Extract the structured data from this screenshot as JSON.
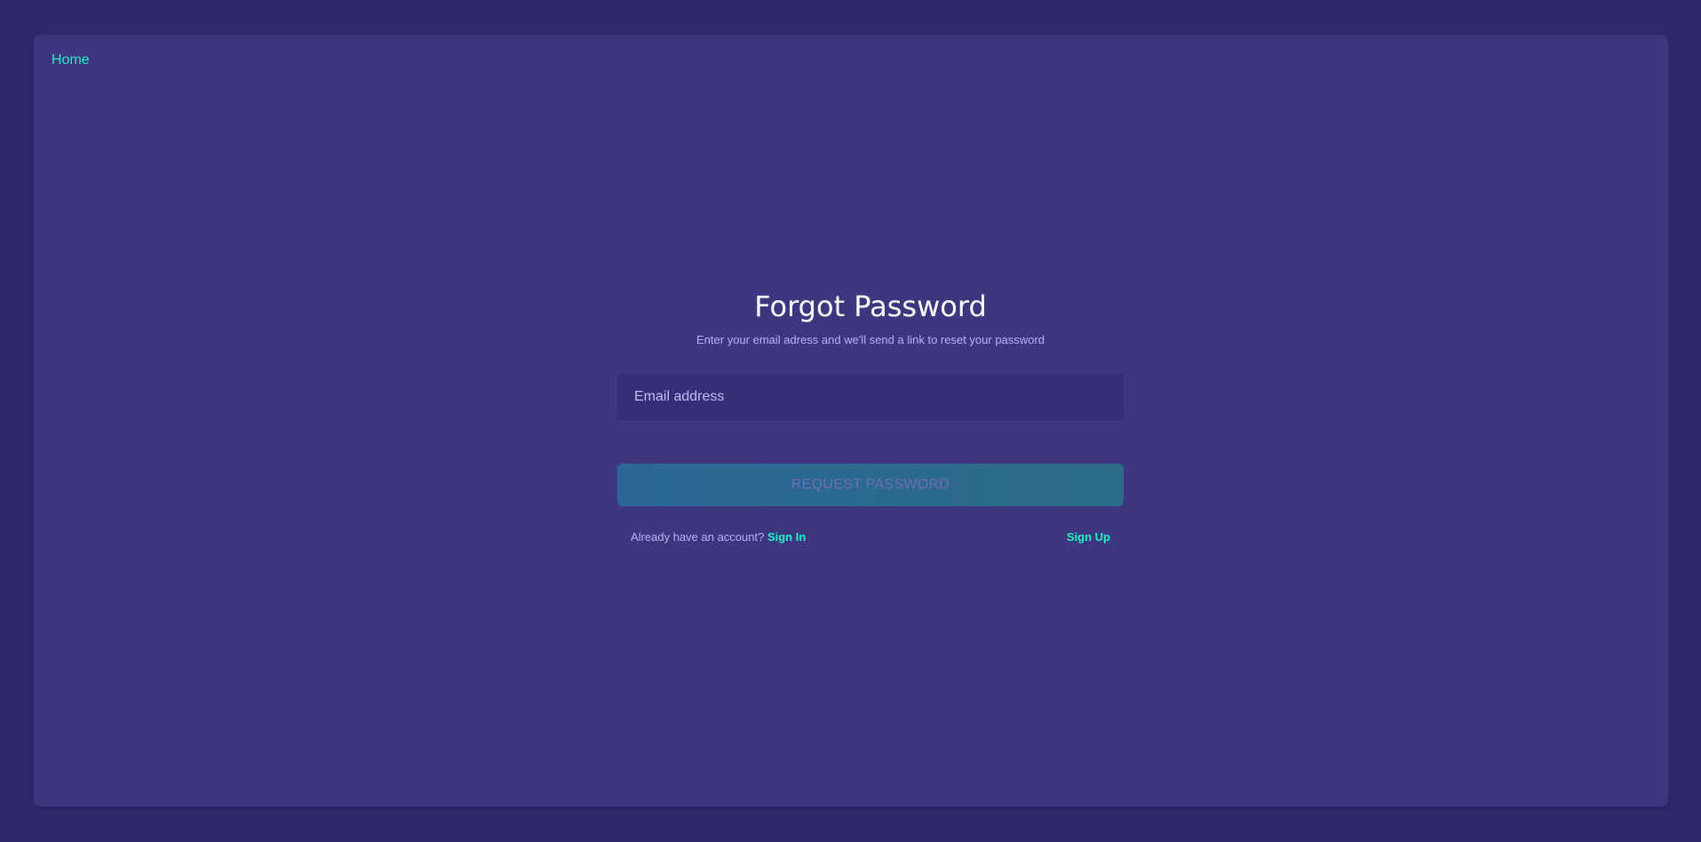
{
  "nav": {
    "home_label": "Home"
  },
  "form": {
    "title": "Forgot Password",
    "subtitle": "Enter your email adress and we'll send a link to reset your password",
    "email_placeholder": "Email address",
    "email_value": "",
    "submit_label": "REQUEST PASSWORD"
  },
  "footer": {
    "account_prompt": "Already have an account?",
    "sign_in_label": "Sign In",
    "sign_up_label": "Sign Up"
  },
  "colors": {
    "page_background": "#2f296b",
    "panel_background": "#3c377f",
    "accent": "#22f1c4",
    "title_text": "#ffffff",
    "muted_text": "#b9b3f0",
    "input_background": "#362f78",
    "button_gradient_start": "#2c6795",
    "button_gradient_end": "#2d6c86",
    "button_text": "#716ab8"
  }
}
